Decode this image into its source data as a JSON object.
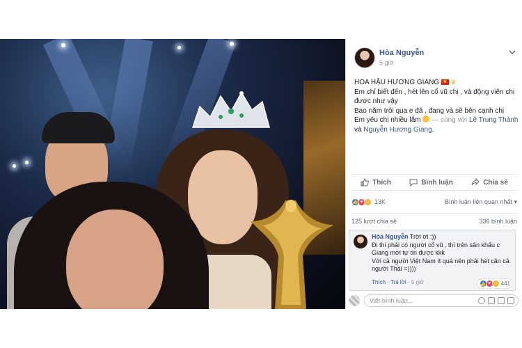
{
  "post": {
    "author": "Hòa Nguyễn",
    "time": "5 giờ",
    "caption": {
      "line1": "HOA HẬU HƯƠNG GIANG",
      "line2": "Em chỉ biết đến , hét lên cổ vũ chị , và động viên chị được như vậy",
      "line3": "Bao năm trôi qua e đã , đang và sẽ bên cạnh chị",
      "line4_prefix": "Em yêu chị nhiều lắm",
      "with_text": " — cùng với ",
      "tag1": "Lê Trung Thành",
      "and_text": " và ",
      "tag2": "Nguyễn Hương Giang",
      "end": "."
    },
    "actions": {
      "like": "Thích",
      "comment": "Bình luận",
      "share": "Chia sẻ"
    },
    "reactions": {
      "count": "13K",
      "relevant": "Bình luận liên quan nhất"
    },
    "shares": "125 lượt chia sẻ",
    "comments_count": "336 bình luận"
  },
  "comment": {
    "author": "Hòa Nguyễn",
    "first": " Trời ơi :))",
    "line2": "Đi thi phải có người cổ vũ , thì trên sân khấu c Giang mới tự tin được kkk",
    "line3": "Với cả người Việt Nam ít quá nên phải hét cân cả người Thái =))))",
    "like": "Thích",
    "reply": "Trả lời",
    "time": "5 giờ",
    "react_count": "441"
  },
  "composer": {
    "placeholder": "Viết bình luận..."
  },
  "colors": {
    "link": "#365899",
    "like_blue": "#1877f2",
    "love_red": "#f33e58",
    "haha_yellow": "#f7b125"
  },
  "icons": [
    "chevron-down-icon",
    "like-icon",
    "comment-icon",
    "share-icon",
    "emoji-icon",
    "camera-icon",
    "gif-icon",
    "sticker-icon"
  ]
}
